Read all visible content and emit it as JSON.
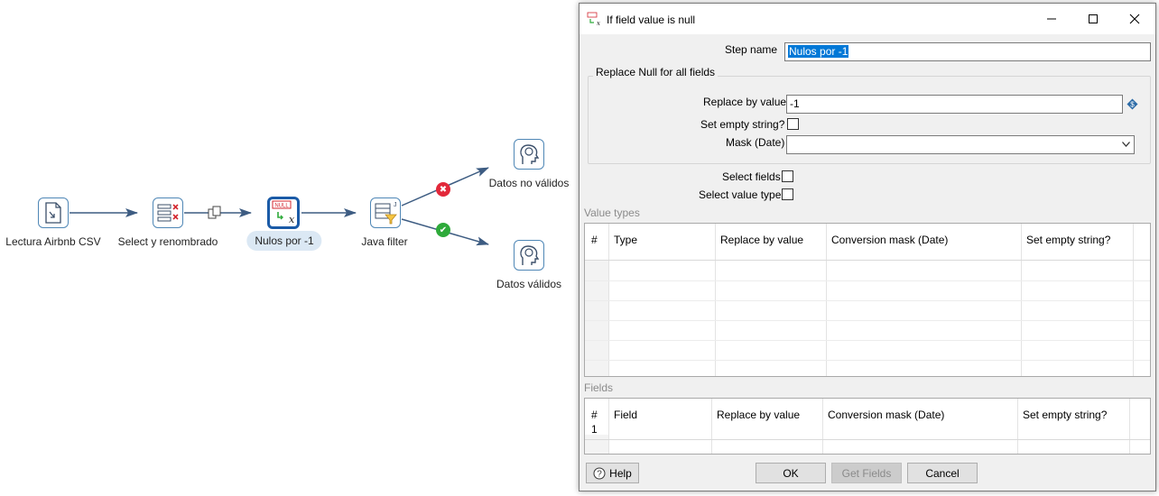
{
  "canvas": {
    "steps": [
      {
        "id": "read",
        "label": "Lectura Airbnb CSV",
        "icon": "csv-input-icon"
      },
      {
        "id": "select",
        "label": "Select y renombrado",
        "icon": "select-values-icon"
      },
      {
        "id": "nulls",
        "label": "Nulos por -1",
        "icon": "if-null-icon",
        "null_badge": "NULL",
        "selected": true
      },
      {
        "id": "filter",
        "label": "Java filter",
        "icon": "java-filter-icon"
      },
      {
        "id": "invalid",
        "label": "Datos no válidos",
        "icon": "dummy-step-icon"
      },
      {
        "id": "valid",
        "label": "Datos válidos",
        "icon": "dummy-step-icon"
      }
    ],
    "colors": {
      "hop": "#3d5c82",
      "false_badge": "#e2283a",
      "true_badge": "#2eaa3a",
      "selected_border": "#1b5ba7"
    }
  },
  "dialog": {
    "title": "If field value is null",
    "step_name_label": "Step name",
    "step_name_value": "Nulos por -1",
    "replace_all_group": "Replace Null for all fields",
    "replace_by_value_label": "Replace by value",
    "replace_by_value": "-1",
    "set_empty_string_label": "Set empty string?",
    "mask_date_label": "Mask (Date)",
    "mask_date_value": "",
    "select_fields_label": "Select fields",
    "select_value_type_label": "Select value type",
    "value_types_title": "Value types",
    "value_types_columns": [
      "#",
      "Type",
      "Replace by value",
      "Conversion mask (Date)",
      "Set empty string?"
    ],
    "fields_title": "Fields",
    "fields_columns": [
      "#",
      "Field",
      "Replace by value",
      "Conversion mask (Date)",
      "Set empty string?"
    ],
    "fields_rows": [
      {
        "num": "1"
      }
    ],
    "buttons": {
      "help": "Help",
      "ok": "OK",
      "get_fields": "Get Fields",
      "cancel": "Cancel"
    }
  }
}
